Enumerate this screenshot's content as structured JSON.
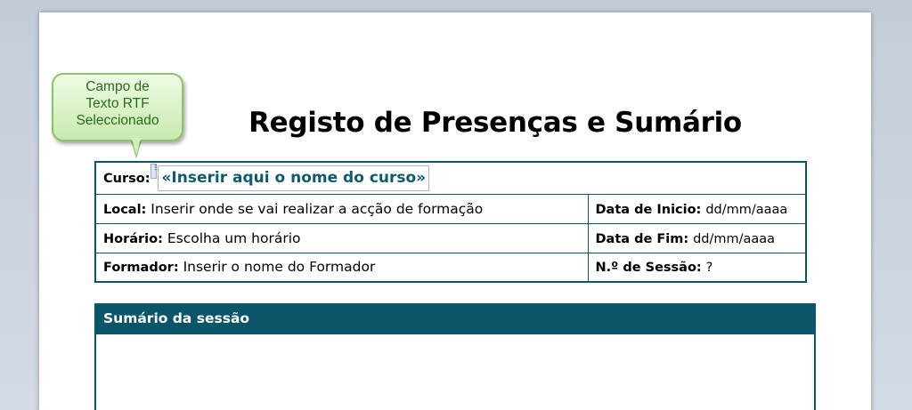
{
  "callout": {
    "line1": "Campo de",
    "line2": "Texto RTF",
    "line3": "Seleccionado"
  },
  "document": {
    "title": "Registo de Presenças e Sumário",
    "info_table": {
      "curso_label": "Curso:",
      "curso_value": "«Inserir aqui o nome do curso»",
      "local_label": "Local:",
      "local_value": "Inserir onde se vai realizar a acção de formação",
      "data_inicio_label": "Data de Inicio:",
      "data_inicio_value": "dd/mm/aaaa",
      "horario_label": "Horário:",
      "horario_value": "Escolha um horário",
      "data_fim_label": "Data de Fim:",
      "data_fim_value": "dd/mm/aaaa",
      "formador_label": "Formador:",
      "formador_value": "Inserir o nome do Formador",
      "sessao_label": "N.º de Sessão:",
      "sessao_value": "?"
    },
    "summary": {
      "header": "Sumário da sessão"
    }
  },
  "colors": {
    "accent_teal": "#0a5568",
    "callout_green": "#c8eaae",
    "callout_text": "#2a6b1a"
  }
}
